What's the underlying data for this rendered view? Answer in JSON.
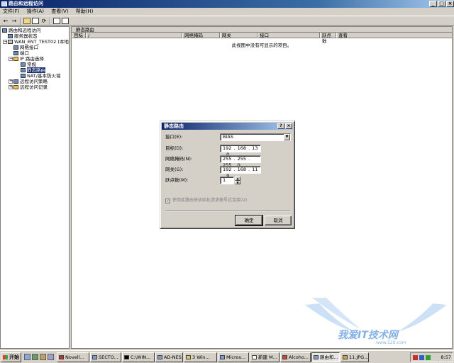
{
  "window": {
    "title": "路由和远程访问",
    "min": "_",
    "max": "□",
    "close": "×"
  },
  "menu": [
    "文件(F)",
    "操作(A)",
    "查看(V)",
    "帮助(H)"
  ],
  "toolbar": [
    "back-arrow-icon",
    "forward-arrow-icon",
    "up-folder-icon",
    "properties-icon",
    "refresh-icon",
    "export-icon",
    "help-icon"
  ],
  "tree": {
    "root": "路由和远程访问",
    "server_status": "服务器状态",
    "server": "WAN_ENT_TEST02 (本地)",
    "network_interfaces": "网络接口",
    "ports": "端口",
    "ip_routing": "IP 路由选择",
    "general": "常规",
    "static_routes": "静态路由",
    "nat": "NAT/基本防火墙",
    "remote_policies": "远程访问策略",
    "remote_logging": "远程访问记录"
  },
  "list": {
    "pane_title": "静态路由",
    "columns": [
      "目标",
      "/",
      "网络掩码",
      "网关",
      "接口",
      "跃点数",
      "查看"
    ],
    "empty_message": "此视图中没有可显示的项目。"
  },
  "dialog": {
    "title": "静态路由",
    "help_btn": "?",
    "close_btn": "×",
    "interface_label": "接口(E):",
    "interface_value": "BIAS",
    "dest_label": "目标(D):",
    "dest_value": "192 . 168 . 13 . 0",
    "mask_label": "网络掩码(N):",
    "mask_value": "255 . 255 . 255 . 0",
    "gateway_label": "网关(G):",
    "gateway_value": "192 . 168 . 11 . 9",
    "metric_label": "跃点数(M):",
    "metric_value": "1",
    "checkbox_label": "使用此路由来初始化请求拨号式连接(U)",
    "checkbox_mark": "✓",
    "ok": "确定",
    "cancel": "取消"
  },
  "taskbar": {
    "start": "开始",
    "tasks": [
      "Novell...",
      "SECTO...",
      "C:\\WIN...",
      "AD-NES...",
      "3 Win...",
      "Micros...",
      "新建 M...",
      "Alcoho...",
      "路由和...",
      "11.JPG..."
    ],
    "clock": "8:57"
  },
  "watermark": {
    "text": "我爱IT技术网",
    "url": "www.52it.com"
  }
}
